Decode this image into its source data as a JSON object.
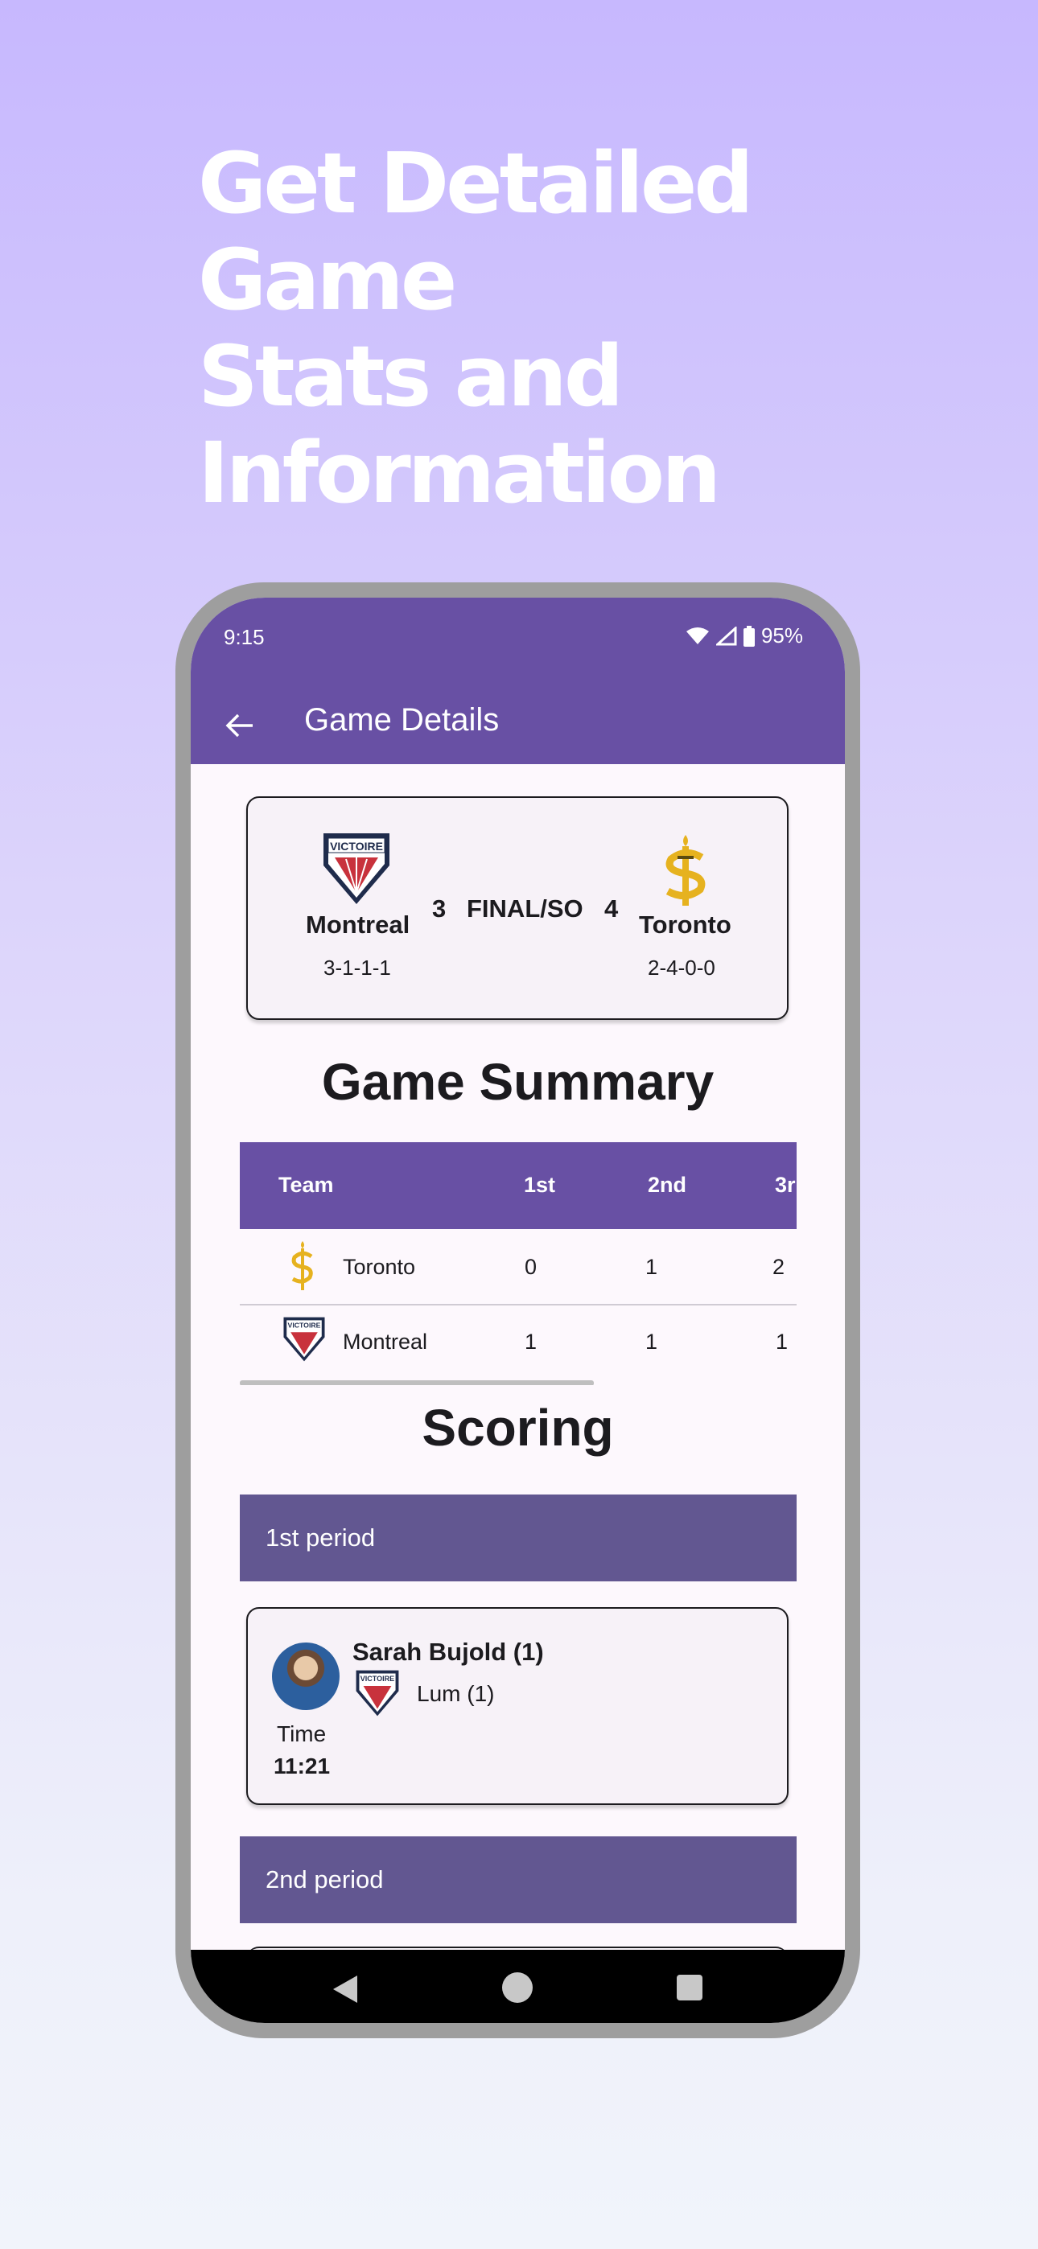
{
  "headline": {
    "line1": "Get Detailed Game",
    "line2": "Stats and",
    "line3": "Information"
  },
  "status_bar": {
    "time": "9:15",
    "battery": "95%"
  },
  "appbar": {
    "title": "Game Details"
  },
  "score_card": {
    "home": {
      "name": "Montreal",
      "record": "3-1-1-1",
      "score": "3",
      "logo": "victoire-logo"
    },
    "away": {
      "name": "Toronto",
      "record": "2-4-0-0",
      "score": "4",
      "logo": "sceptres-logo"
    },
    "status": "FINAL/SO"
  },
  "game_summary": {
    "title": "Game Summary",
    "columns": [
      "Team",
      "1st",
      "2nd",
      "3r"
    ],
    "rows": [
      {
        "team": "Toronto",
        "p1": "0",
        "p2": "1",
        "p3": "2"
      },
      {
        "team": "Montreal",
        "p1": "1",
        "p2": "1",
        "p3": "1"
      }
    ]
  },
  "scoring": {
    "title": "Scoring",
    "periods": [
      {
        "label": "1st period",
        "goals": [
          {
            "scorer": "Sarah Bujold (1)",
            "assist": "Lum (1)",
            "time_label": "Time",
            "time": "11:21"
          }
        ]
      },
      {
        "label": "2nd period"
      }
    ]
  },
  "colors": {
    "primary": "#6850a4",
    "period_header": "#625791",
    "toronto_gold": "#e6b21f",
    "montreal_red": "#c8323c",
    "montreal_navy": "#1f2c4c"
  }
}
